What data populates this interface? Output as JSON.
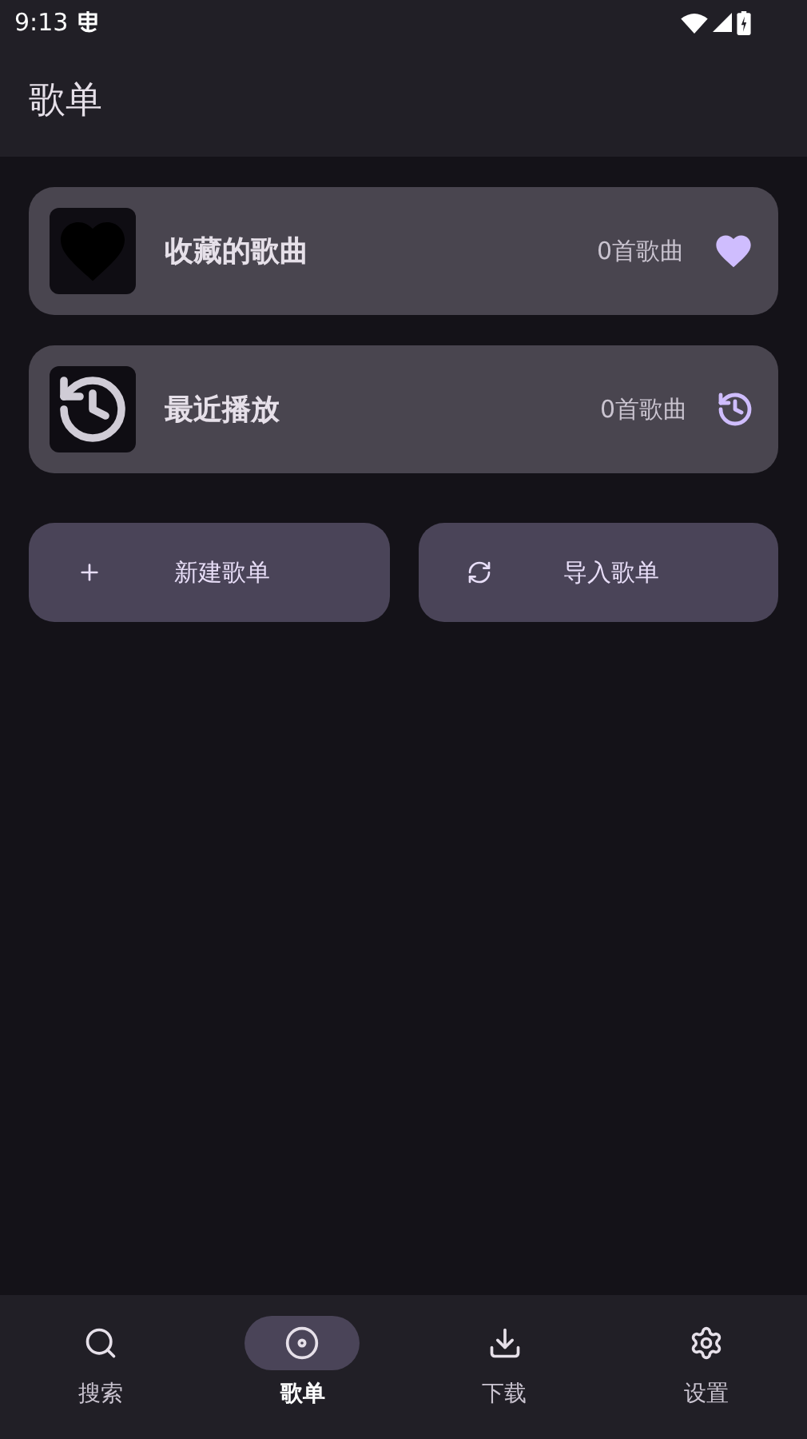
{
  "status_bar": {
    "time": "9:13"
  },
  "header": {
    "title": "歌单"
  },
  "playlists": [
    {
      "kind": "favorites",
      "name": "收藏的歌曲",
      "count": "0首歌曲"
    },
    {
      "kind": "recent",
      "name": "最近播放",
      "count": "0首歌曲"
    }
  ],
  "actions": [
    {
      "kind": "create",
      "label": "新建歌单"
    },
    {
      "kind": "import",
      "label": "导入歌单"
    }
  ],
  "nav": [
    {
      "kind": "search",
      "label": "搜索",
      "selected": false
    },
    {
      "kind": "playlist",
      "label": "歌单",
      "selected": true
    },
    {
      "kind": "download",
      "label": "下载",
      "selected": false
    },
    {
      "kind": "settings",
      "label": "设置",
      "selected": false
    }
  ]
}
